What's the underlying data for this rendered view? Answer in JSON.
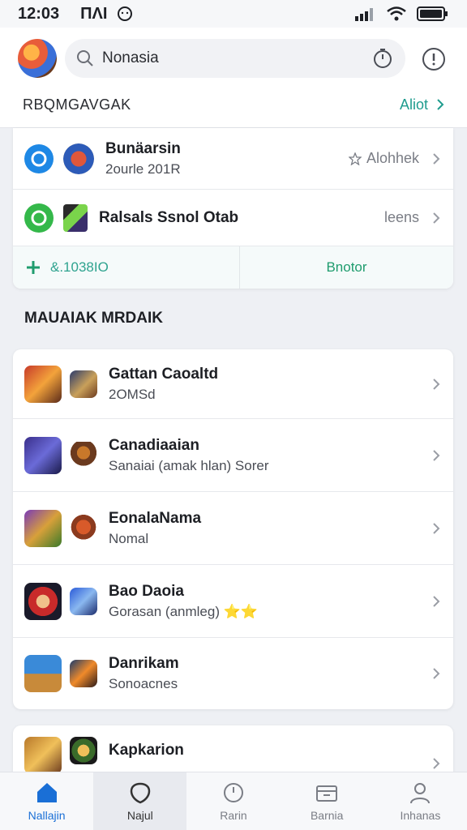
{
  "status": {
    "time": "12:03",
    "carrier": "ПΛΙ"
  },
  "search": {
    "value": "Nonasia"
  },
  "header": {
    "title": "RBQMGAVGAK",
    "action": "Aliot"
  },
  "top_card": {
    "rows": [
      {
        "title": "Bunäarsin",
        "subtitle": "2ourle 201R",
        "trail": "Alohhek"
      },
      {
        "title": "Ralsals Ssnol Otab",
        "subtitle": "",
        "trail": "leens"
      }
    ],
    "footer": {
      "left": "&.1038IO",
      "right": "Bnotor"
    }
  },
  "section": {
    "title": "MAUAIAK MRDAIK"
  },
  "list": [
    {
      "title": "Gattan Caoaltd",
      "subtitle": "2OMSd"
    },
    {
      "title": "Canadiaaian",
      "subtitle": "Sanaiai (amak hlan) Sorer"
    },
    {
      "title": "EonalaNama",
      "subtitle": "Nomal"
    },
    {
      "title": "Bao Daoia",
      "subtitle": "Gorasan (anmleg) ⭐⭐"
    },
    {
      "title": "Danrikam",
      "subtitle": "Sonoacnes"
    }
  ],
  "partial": {
    "title": "Kapkarion"
  },
  "nav": [
    {
      "label": "Nallajin"
    },
    {
      "label": "Najul"
    },
    {
      "label": "Rarin"
    },
    {
      "label": "Barnia"
    },
    {
      "label": "Inhanas"
    }
  ],
  "colors": {
    "accent": "#1f9c8e",
    "nav_active": "#1a6fd6"
  }
}
